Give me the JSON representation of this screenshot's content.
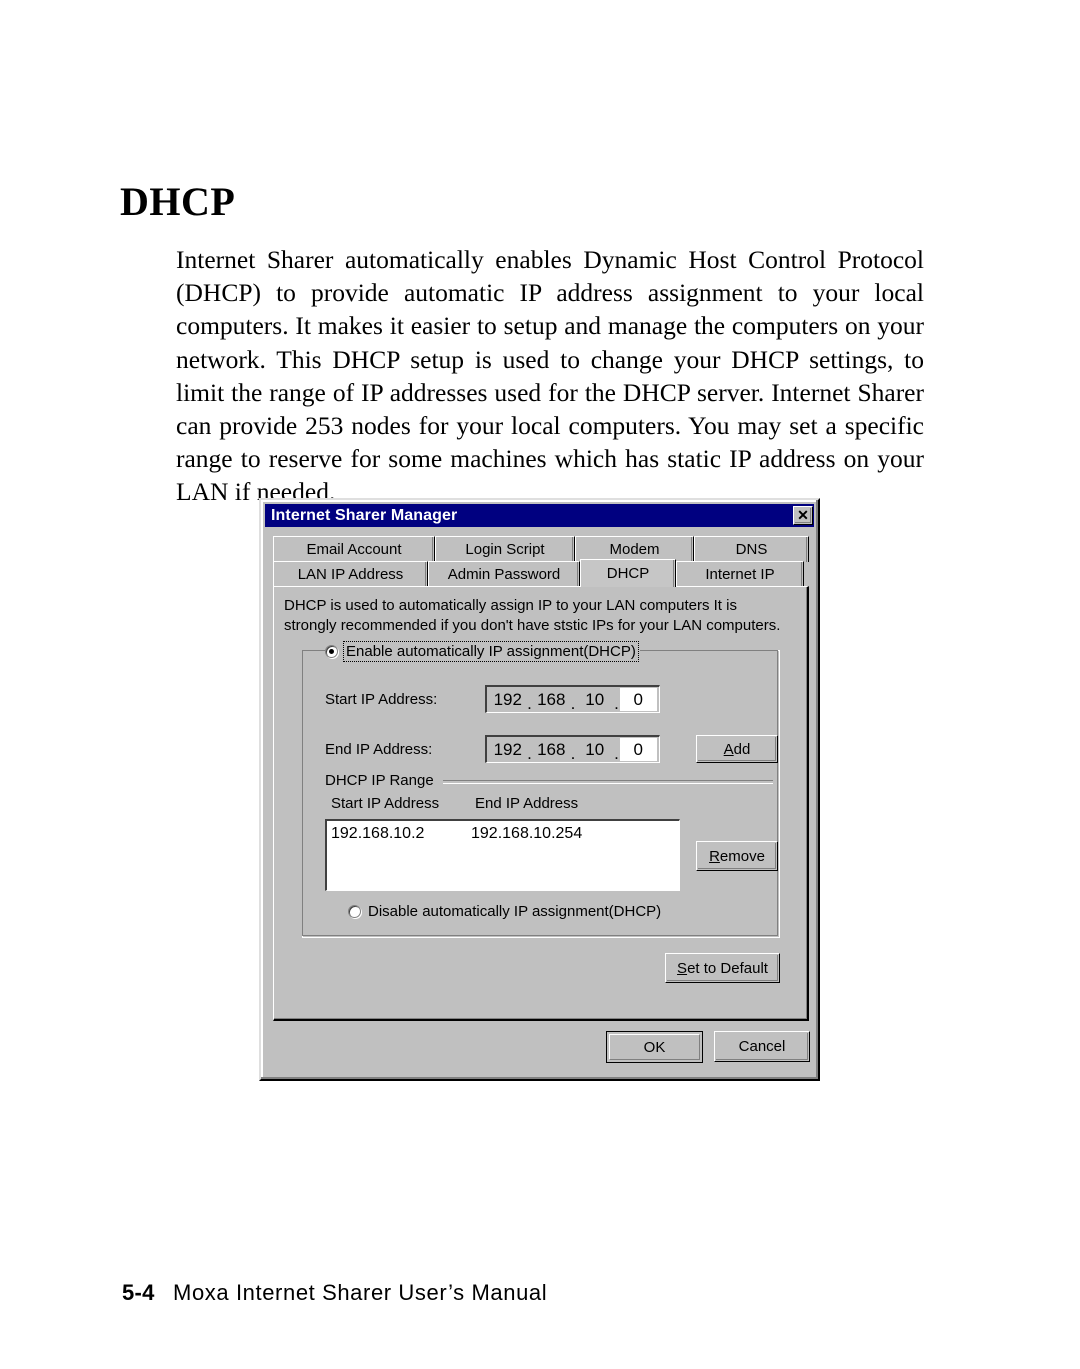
{
  "page": {
    "heading": "DHCP",
    "body": "Internet Sharer automatically enables Dynamic Host Control Protocol (DHCP) to provide automatic IP address assignment to your local computers. It makes it easier to setup and manage the computers on your network. This DHCP setup is used to change your DHCP settings, to limit the range of IP addresses used for the DHCP server. Internet Sharer can provide 253 nodes for your local computers. You may set a specific range to reserve for some machines which has static IP address on your LAN if needed.",
    "footer_page_number": "5-4",
    "footer_title": "Moxa Internet Sharer User’s Manual"
  },
  "dialog": {
    "title": "Internet Sharer Manager",
    "close_glyph": "✕",
    "tabs_row_top": [
      {
        "label": "Email Account",
        "active": false
      },
      {
        "label": "Login Script",
        "active": false
      },
      {
        "label": "Modem",
        "active": false
      },
      {
        "label": "DNS",
        "active": false
      }
    ],
    "tabs_row_bottom": [
      {
        "label": "LAN IP Address",
        "active": false
      },
      {
        "label": "Admin Password",
        "active": false
      },
      {
        "label": "DHCP",
        "active": true
      },
      {
        "label": "Internet IP",
        "active": false
      }
    ],
    "panel": {
      "description": "DHCP is used to automatically assign IP to your LAN computers It is strongly recommended if you don't have ststic IPs for your LAN computers.",
      "enable_radio_label": "Enable automatically IP assignment(DHCP)",
      "enable_radio_checked": true,
      "disable_radio_label": "Disable automatically IP assignment(DHCP)",
      "disable_radio_checked": false,
      "start_ip_label": "Start IP Address:",
      "end_ip_label": "End IP Address:",
      "start_ip_octets": [
        "192",
        "168",
        "10",
        "0"
      ],
      "end_ip_octets": [
        "192",
        "168",
        "10",
        "0"
      ],
      "add_button": "Add",
      "add_button_accel": "A",
      "range_group_title": "DHCP IP Range",
      "range_col_start": "Start IP Address",
      "range_col_end": "End IP Address",
      "range_rows": [
        {
          "start": "192.168.10.2",
          "end": "192.168.10.254"
        }
      ],
      "remove_button": "Remove",
      "remove_button_accel": "R",
      "set_default_button": "Set to Default",
      "set_default_accel": "S"
    },
    "ok_button": "OK",
    "cancel_button": "Cancel"
  },
  "colors": {
    "titlebar": "#000080",
    "face": "#c0c0c0",
    "field": "#ffffff",
    "text": "#000000"
  }
}
